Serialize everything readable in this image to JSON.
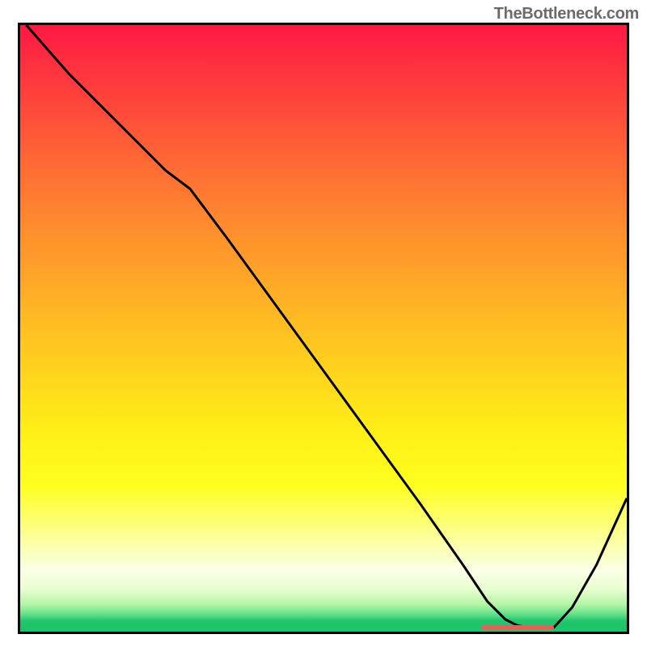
{
  "watermark": "TheBottleneck.com",
  "chart_data": {
    "type": "line",
    "title": "",
    "xlabel": "",
    "ylabel": "",
    "x_range": [
      0,
      100
    ],
    "y_range": [
      0,
      100
    ],
    "series": [
      {
        "name": "curve",
        "x": [
          1,
          8,
          16,
          24,
          28,
          34,
          42,
          50,
          58,
          66,
          73,
          77,
          80,
          82,
          85,
          88,
          91,
          95,
          100
        ],
        "y": [
          100,
          92,
          84,
          76,
          73,
          65,
          54,
          43,
          32,
          21,
          11,
          5,
          2,
          1,
          0.5,
          0.7,
          4,
          11,
          22
        ]
      }
    ],
    "marker": {
      "name": "highlight-segment",
      "x_start": 76,
      "x_end": 88,
      "y": 0.7,
      "color": "#e2625a"
    },
    "background_gradient": {
      "top": "#ff1842",
      "mid": "#ffe020",
      "pale": "#fcffe0",
      "bottom": "#1cc46a"
    }
  }
}
